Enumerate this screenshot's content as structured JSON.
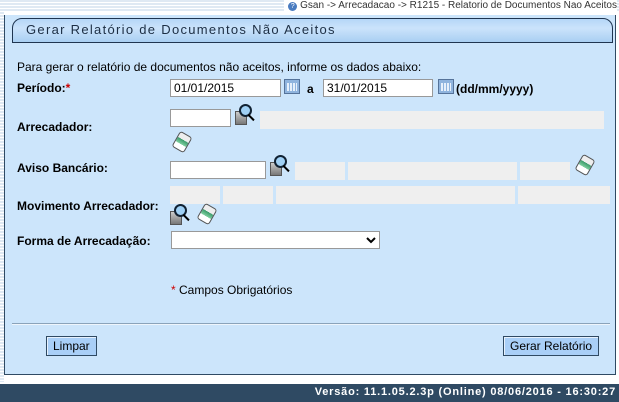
{
  "breadcrumb": "Gsan -> Arrecadacao -> R1215 - Relatorio de Documentos Nao Aceitos",
  "form": {
    "title": "Gerar Relatório de Documentos Não Aceitos",
    "intro": "Para gerar o relatório de documentos não aceitos, informe os dados abaixo:",
    "periodo_label": "Período:",
    "required_mark": "*",
    "periodo_inicio": "01/01/2015",
    "periodo_sep": "a",
    "periodo_fim": "31/01/2015",
    "date_format": "(dd/mm/yyyy)",
    "arrecadador_label": "Arrecadador:",
    "arrecadador_value": "",
    "aviso_label": "Aviso Bancário:",
    "aviso_value": "",
    "movimento_label": "Movimento Arrecadador:",
    "forma_label": "Forma de Arrecadação:",
    "forma_value": "",
    "required_note": "Campos Obrigatórios"
  },
  "buttons": {
    "limpar": "Limpar",
    "gerar": "Gerar Relatório"
  },
  "footer": "Versão: 11.1.05.2.3p (Online) 08/06/2016 - 16:30:27",
  "colors": {
    "panel": "#cce5fb",
    "footer": "#2f4a63",
    "button": "#a9cff7"
  }
}
